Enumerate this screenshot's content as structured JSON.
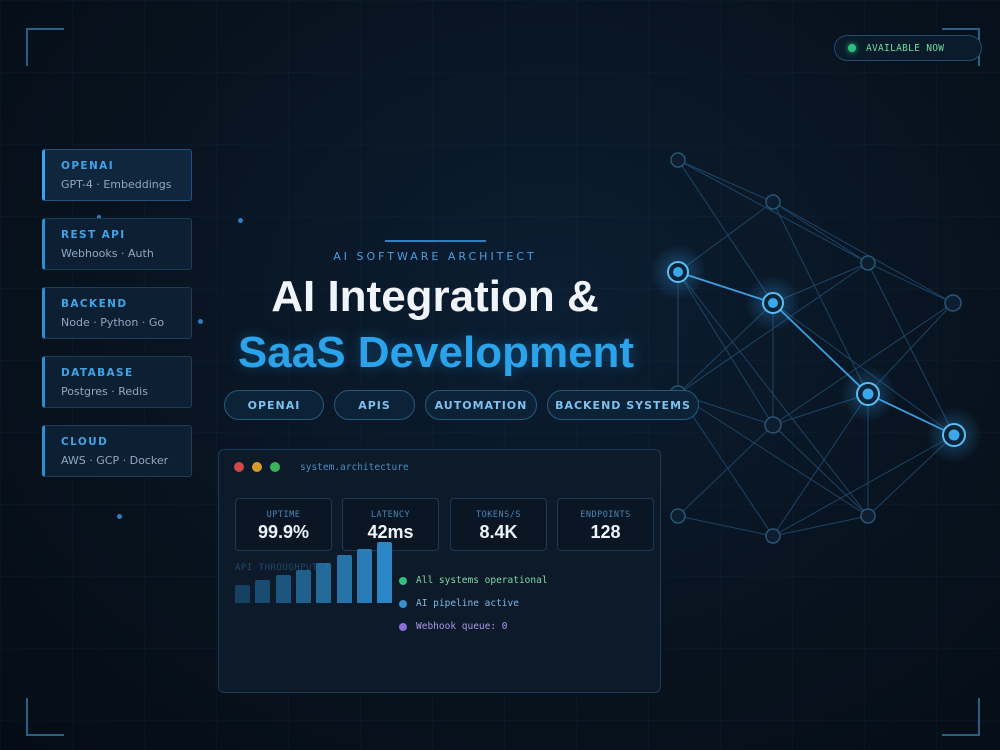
{
  "badge": {
    "label": "AVAILABLE NOW",
    "dot_color": "#2ec27e"
  },
  "sidebar": {
    "items": [
      {
        "title": "OPENAI",
        "detail": "GPT-4 · Embeddings"
      },
      {
        "title": "REST API",
        "detail": "Webhooks · Auth"
      },
      {
        "title": "BACKEND",
        "detail": "Node · Python · Go"
      },
      {
        "title": "DATABASE",
        "detail": "Postgres · Redis"
      },
      {
        "title": "CLOUD",
        "detail": "AWS · GCP · Docker"
      }
    ]
  },
  "hero": {
    "eyebrow": "AI SOFTWARE ARCHITECT",
    "title_line1": "AI Integration &",
    "title_line2": "SaaS Development",
    "accent_color": "#2aa3ea"
  },
  "chips": [
    "OPENAI",
    "APIS",
    "AUTOMATION",
    "BACKEND SYSTEMS"
  ],
  "panel": {
    "window_title": "system.architecture",
    "traffic_lights": [
      "#d04848",
      "#d89a2a",
      "#3cb35a"
    ],
    "stats": [
      {
        "label": "UPTIME",
        "value": "99.9%"
      },
      {
        "label": "LATENCY",
        "value": "42ms"
      },
      {
        "label": "TOKENS/S",
        "value": "8.4K"
      },
      {
        "label": "ENDPOINTS",
        "value": "128"
      }
    ],
    "throughput_label": "API THROUGHPUT /",
    "throughput_values": [
      22,
      28,
      34,
      40,
      48,
      58,
      66,
      74
    ],
    "status_lines": [
      {
        "text": "All systems operational",
        "color": "#2ec27e"
      },
      {
        "text": "AI pipeline active",
        "color": "#3a8fd0"
      },
      {
        "text": "Webhook queue: 0",
        "color": "#8a6fd8"
      }
    ]
  },
  "network_icon": "network-graph-icon"
}
